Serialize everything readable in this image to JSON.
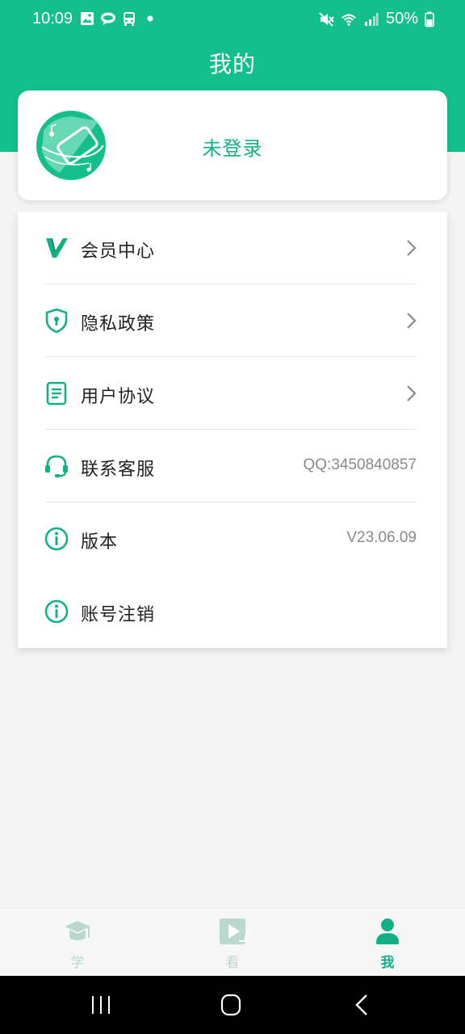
{
  "status_bar": {
    "time": "10:09",
    "battery": "50%",
    "left_icons": [
      "image-icon",
      "chat-icon",
      "bus-icon",
      "dot-icon"
    ],
    "right_icons": [
      "mute-icon",
      "wifi-icon",
      "signal-icon",
      "battery-icon"
    ]
  },
  "header": {
    "title": "我的",
    "background_color": "#13c08c"
  },
  "profile": {
    "login_label": "未登录",
    "avatar_icon": "app-logo-avatar"
  },
  "menu": {
    "items": [
      {
        "icon": "vip-icon",
        "label": "会员中心",
        "value": "",
        "chevron": true
      },
      {
        "icon": "shield-lock-icon",
        "label": "隐私政策",
        "value": "",
        "chevron": true
      },
      {
        "icon": "document-icon",
        "label": "用户协议",
        "value": "",
        "chevron": true
      },
      {
        "icon": "headset-icon",
        "label": "联系客服",
        "value": "QQ:3450840857",
        "chevron": false
      },
      {
        "icon": "info-icon",
        "label": "版本",
        "value": "V23.06.09",
        "chevron": false
      },
      {
        "icon": "info-icon",
        "label": "账号注销",
        "value": "",
        "chevron": false
      }
    ]
  },
  "bottom_nav": {
    "tabs": [
      {
        "icon": "graduation-cap-icon",
        "label": "学",
        "active": false
      },
      {
        "icon": "play-video-icon",
        "label": "看",
        "active": false
      },
      {
        "icon": "person-icon",
        "label": "我",
        "active": true
      }
    ]
  },
  "colors": {
    "accent": "#13c08c",
    "text_accent": "#13b088",
    "inactive_tab": "#b9d8cf"
  }
}
